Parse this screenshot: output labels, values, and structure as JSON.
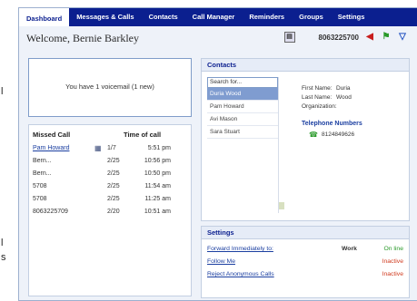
{
  "left_strip": {
    "chars": [
      "l",
      "l",
      "s"
    ]
  },
  "nav": {
    "tabs": [
      {
        "label": "Dashboard",
        "active": true
      },
      {
        "label": "Messages & Calls",
        "active": false
      },
      {
        "label": "Contacts",
        "active": false
      },
      {
        "label": "Call Manager",
        "active": false
      },
      {
        "label": "Reminders",
        "active": false
      },
      {
        "label": "Groups",
        "active": false
      },
      {
        "label": "Settings",
        "active": false
      }
    ]
  },
  "header": {
    "welcome": "Welcome, Bernie Barkley",
    "phone": "8063225700"
  },
  "voicemail": {
    "message": "You have 1 voicemail (1 new)"
  },
  "missed_calls": {
    "col_caller": "Missed Call",
    "col_time": "Time of call",
    "rows": [
      {
        "caller": "Pam Howard",
        "date": "1/7",
        "time": "5:51 pm",
        "link": true
      },
      {
        "caller": "Bern...",
        "date": "2/25",
        "time": "10:56 pm",
        "link": false
      },
      {
        "caller": "Bern...",
        "date": "2/25",
        "time": "10:50 pm",
        "link": false
      },
      {
        "caller": "5708",
        "date": "2/25",
        "time": "11:54 am",
        "link": false
      },
      {
        "caller": "5708",
        "date": "2/25",
        "time": "11:25 am",
        "link": false
      },
      {
        "caller": "8063225709",
        "date": "2/20",
        "time": "10:51 am",
        "link": false
      }
    ]
  },
  "contacts": {
    "title": "Contacts",
    "search_value": "Search for...",
    "items": [
      {
        "name": "Duria Wood",
        "selected": true
      },
      {
        "name": "Pam Howard",
        "selected": false
      },
      {
        "name": "Avi Mason",
        "selected": false
      },
      {
        "name": "Sara Stuart",
        "selected": false
      }
    ],
    "details": {
      "first_name_label": "First Name:",
      "first_name": "Duria",
      "last_name_label": "Last Name:",
      "last_name": "Wood",
      "organization_label": "Organization:"
    },
    "telephone_title": "Telephone Numbers",
    "telephone": "8124849626"
  },
  "settings": {
    "title": "Settings",
    "rows": [
      {
        "label": "Forward Immediately to:",
        "value": "Work",
        "status": "On line",
        "state": "on"
      },
      {
        "label": "Follow Me",
        "value": "",
        "status": "Inactive",
        "state": "off"
      },
      {
        "label": "Reject Anonymous Calls",
        "value": "",
        "status": "Inactive",
        "state": "off"
      }
    ]
  }
}
